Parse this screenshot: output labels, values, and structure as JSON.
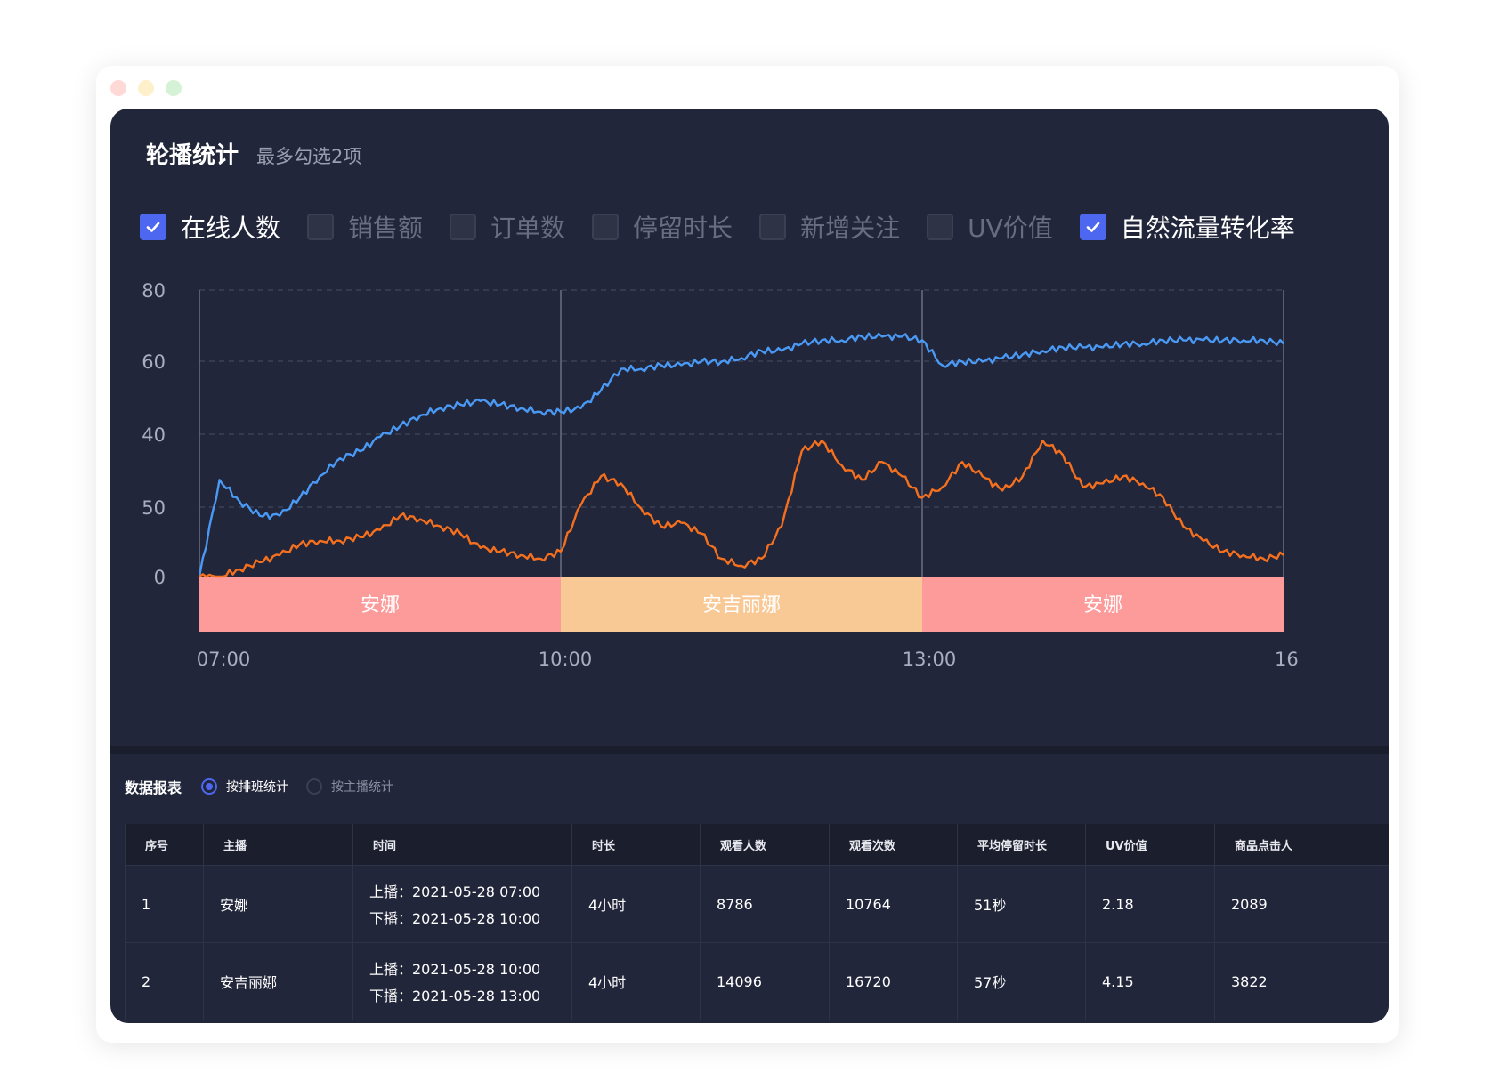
{
  "panel": {
    "title": "轮播统计",
    "subtitle": "最多勾选2项"
  },
  "metrics": [
    {
      "label": "在线人数",
      "checked": true
    },
    {
      "label": "销售额",
      "checked": false
    },
    {
      "label": "订单数",
      "checked": false
    },
    {
      "label": "停留时长",
      "checked": false
    },
    {
      "label": "新增关注",
      "checked": false
    },
    {
      "label": "UV价值",
      "checked": false
    },
    {
      "label": "自然流量转化率",
      "checked": true
    }
  ],
  "colors": {
    "online": "#4a9af5",
    "conversion": "#f5701e",
    "band_anna": "#fd9a9a",
    "band_angelina": "#f8c895",
    "accent": "#4d67f0"
  },
  "chart_data": {
    "type": "line",
    "y_tick_labels": [
      "80",
      "60",
      "40",
      "50",
      "0"
    ],
    "x_tick_labels": [
      "07:00",
      "10:00",
      "13:00",
      "16"
    ],
    "grid": true,
    "shift_bands": [
      {
        "label": "安娜",
        "start": "07:00",
        "end": "10:00",
        "color": "#fd9a9a"
      },
      {
        "label": "安吉丽娜",
        "start": "10:00",
        "end": "13:00",
        "color": "#f8c895"
      },
      {
        "label": "安娜",
        "start": "13:00",
        "end": "16:00",
        "color": "#fd9a9a"
      }
    ],
    "x": [
      "07:00",
      "07:10",
      "07:20",
      "07:30",
      "07:40",
      "07:50",
      "08:00",
      "08:10",
      "08:20",
      "08:30",
      "08:40",
      "08:50",
      "09:00",
      "09:10",
      "09:20",
      "09:30",
      "09:40",
      "09:50",
      "10:00",
      "10:10",
      "10:20",
      "10:30",
      "10:40",
      "10:50",
      "11:00",
      "11:10",
      "11:20",
      "11:30",
      "11:40",
      "11:50",
      "12:00",
      "12:10",
      "12:20",
      "12:30",
      "12:40",
      "12:50",
      "13:00",
      "13:10",
      "13:20",
      "13:30",
      "13:40",
      "13:50",
      "14:00",
      "14:10",
      "14:20",
      "14:30",
      "14:40",
      "14:50",
      "15:00",
      "15:10",
      "15:20",
      "15:30",
      "15:40",
      "15:50",
      "16:00"
    ],
    "series": [
      {
        "key": "online",
        "values": [
          0,
          27,
          21,
          17,
          17,
          22,
          28,
          33,
          35,
          39,
          42,
          45,
          47,
          48,
          49,
          48,
          47,
          46,
          46,
          47,
          52,
          58,
          58,
          59,
          59,
          60,
          60,
          61,
          63,
          63,
          65,
          66,
          66,
          67,
          67,
          67,
          66,
          59,
          60,
          60,
          61,
          62,
          63,
          64,
          64,
          64,
          65,
          65,
          66,
          66,
          66,
          66,
          66,
          66,
          65
        ]
      },
      {
        "key": "conversion",
        "values": [
          0,
          0,
          2,
          4,
          6,
          9,
          10,
          10,
          11,
          13,
          17,
          16,
          14,
          12,
          8,
          7,
          6,
          5,
          7,
          20,
          28,
          26,
          19,
          14,
          15,
          12,
          5,
          3,
          5,
          14,
          35,
          38,
          31,
          27,
          32,
          28,
          22,
          25,
          32,
          28,
          24,
          28,
          38,
          34,
          25,
          26,
          28,
          26,
          22,
          14,
          10,
          7,
          6,
          5,
          6
        ]
      }
    ]
  },
  "report": {
    "title": "数据报表",
    "radios": [
      {
        "label": "按排班统计",
        "selected": true
      },
      {
        "label": "按主播统计",
        "selected": false
      }
    ]
  },
  "table": {
    "headers": [
      "序号",
      "主播",
      "时间",
      "时长",
      "观看人数",
      "观看次数",
      "平均停留时长",
      "UV价值",
      "商品点击人"
    ],
    "rows": [
      {
        "cells": [
          "1",
          "安娜",
          "4小时",
          "8786",
          "10764",
          "51秒",
          "2.18",
          "2089"
        ],
        "start": "上播：2021-05-28  07:00",
        "end": "下播：2021-05-28  10:00"
      },
      {
        "cells": [
          "2",
          "安吉丽娜",
          "4小时",
          "14096",
          "16720",
          "57秒",
          "4.15",
          "3822"
        ],
        "start": "上播：2021-05-28  10:00",
        "end": "下播：2021-05-28  13:00"
      }
    ]
  }
}
